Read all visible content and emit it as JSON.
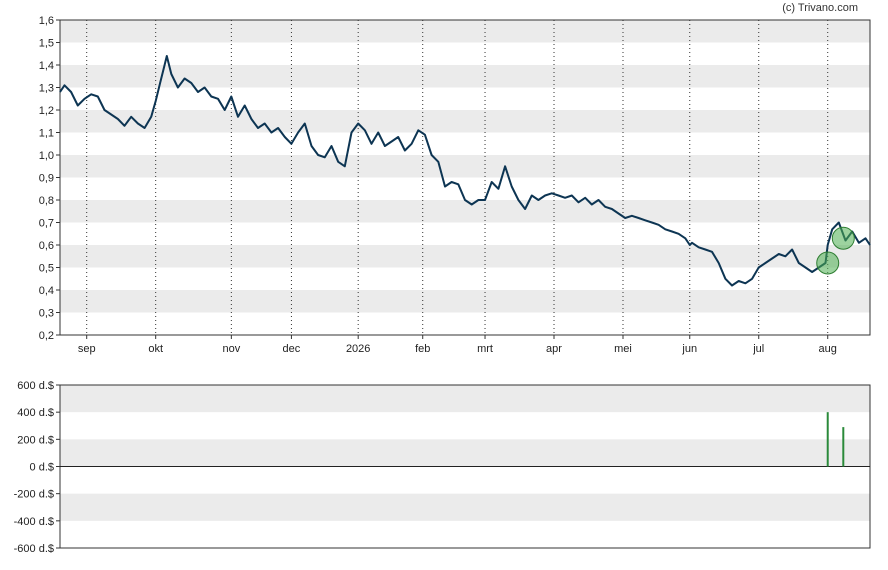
{
  "credit": "(c) Trivano.com",
  "colors": {
    "price_line": "#0d3553",
    "band": "#ebebeb",
    "bar": "#2a8a3a",
    "marker_fill": "#4caf50"
  },
  "chart_data": [
    {
      "type": "line",
      "title": "",
      "ylim": [
        0.2,
        1.6
      ],
      "ytick_labels": [
        "0,2",
        "0,3",
        "0,4",
        "0,5",
        "0,6",
        "0,7",
        "0,8",
        "0,9",
        "1,0",
        "1,1",
        "1,2",
        "1,3",
        "1,4",
        "1,5",
        "1,6"
      ],
      "ytick_values": [
        0.2,
        0.3,
        0.4,
        0.5,
        0.6,
        0.7,
        0.8,
        0.9,
        1.0,
        1.1,
        1.2,
        1.3,
        1.4,
        1.5,
        1.6
      ],
      "xtick_labels": [
        "sep",
        "okt",
        "nov",
        "dec",
        "2026",
        "feb",
        "mrt",
        "apr",
        "mei",
        "jun",
        "jul",
        "aug"
      ],
      "xtick_days": [
        12,
        43,
        77,
        104,
        134,
        163,
        191,
        222,
        253,
        283,
        314,
        345
      ],
      "x_days_total": 364,
      "grid": "vertical dotted at month ticks, alternating horizontal bands",
      "series": [
        {
          "x": [
            0,
            2,
            5,
            8,
            11,
            14,
            17,
            20,
            23,
            26,
            29,
            32,
            35,
            38,
            41,
            43,
            45,
            47,
            48,
            50,
            53,
            56,
            59,
            62,
            65,
            68,
            71,
            74,
            77,
            80,
            83,
            86,
            89,
            92,
            95,
            98,
            101,
            104,
            107,
            110,
            113,
            116,
            119,
            122,
            125,
            128,
            131,
            134,
            137,
            140,
            143,
            146,
            149,
            152,
            155,
            158,
            161,
            164,
            167,
            170,
            173,
            176,
            179,
            182,
            185,
            188,
            191,
            194,
            197,
            200,
            203,
            206,
            209,
            212,
            215,
            218,
            221,
            224,
            227,
            230,
            233,
            236,
            239,
            242,
            245,
            248,
            251,
            254,
            257,
            260,
            263,
            266,
            269,
            272,
            275,
            278,
            281,
            283,
            284,
            287,
            290,
            293,
            296,
            299,
            302,
            305,
            308,
            311,
            314,
            317,
            320,
            323,
            326,
            329,
            332,
            335,
            338,
            341,
            344,
            345,
            347,
            350,
            353,
            356,
            359,
            362,
            364
          ],
          "y": [
            1.28,
            1.31,
            1.28,
            1.22,
            1.25,
            1.27,
            1.26,
            1.2,
            1.18,
            1.16,
            1.13,
            1.17,
            1.14,
            1.12,
            1.17,
            1.24,
            1.32,
            1.4,
            1.44,
            1.36,
            1.3,
            1.34,
            1.32,
            1.28,
            1.3,
            1.26,
            1.25,
            1.2,
            1.26,
            1.17,
            1.22,
            1.16,
            1.12,
            1.14,
            1.1,
            1.12,
            1.08,
            1.05,
            1.1,
            1.14,
            1.04,
            1.0,
            0.99,
            1.04,
            0.97,
            0.95,
            1.1,
            1.14,
            1.11,
            1.05,
            1.1,
            1.04,
            1.06,
            1.08,
            1.02,
            1.05,
            1.11,
            1.09,
            1.0,
            0.97,
            0.86,
            0.88,
            0.87,
            0.8,
            0.78,
            0.8,
            0.8,
            0.88,
            0.85,
            0.95,
            0.86,
            0.8,
            0.76,
            0.82,
            0.8,
            0.82,
            0.83,
            0.82,
            0.81,
            0.82,
            0.79,
            0.81,
            0.78,
            0.8,
            0.77,
            0.76,
            0.74,
            0.72,
            0.73,
            0.72,
            0.71,
            0.7,
            0.69,
            0.67,
            0.66,
            0.65,
            0.63,
            0.6,
            0.61,
            0.59,
            0.58,
            0.57,
            0.52,
            0.45,
            0.42,
            0.44,
            0.43,
            0.45,
            0.5,
            0.52,
            0.54,
            0.56,
            0.55,
            0.58,
            0.52,
            0.5,
            0.48,
            0.5,
            0.52,
            0.6,
            0.67,
            0.7,
            0.62,
            0.66,
            0.61,
            0.63,
            0.6
          ]
        }
      ],
      "markers": [
        {
          "x": 345,
          "y": 0.52
        },
        {
          "x": 352,
          "y": 0.63
        }
      ]
    },
    {
      "type": "bar",
      "title": "",
      "ylim": [
        -600,
        600
      ],
      "ytick_labels": [
        "600 d.$",
        "400 d.$",
        "200 d.$",
        "0 d.$",
        "-200 d.$",
        "-400 d.$",
        "-600 d.$"
      ],
      "ytick_values": [
        600,
        400,
        200,
        0,
        -200,
        -400,
        -600
      ],
      "x_days_total": 364,
      "bars": [
        {
          "x": 345,
          "value": 400
        },
        {
          "x": 352,
          "value": 290
        }
      ]
    }
  ]
}
